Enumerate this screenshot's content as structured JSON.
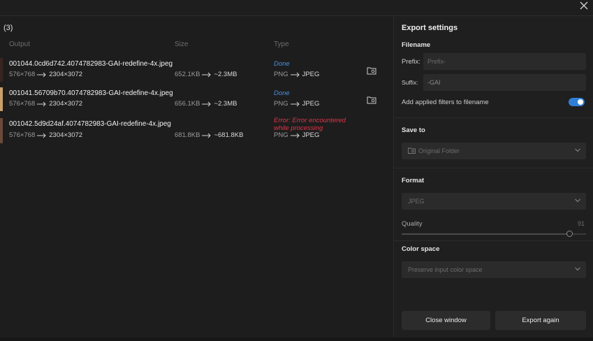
{
  "list": {
    "count": "(3)",
    "columns": {
      "output": "Output",
      "size": "Size",
      "type": "Type"
    },
    "rows": [
      {
        "filename": "001044.0cd6d742.4074782983-GAI-redefine-4x.jpeg",
        "dims_from": "576×768",
        "dims_to": "2304×3072",
        "size_from": "652.1KB",
        "size_to": "~2.3MB",
        "status": "Done",
        "type_from": "PNG",
        "type_to": "JPEG",
        "thumb_color": "#3a2420"
      },
      {
        "filename": "001041.56709b70.4074782983-GAI-redefine-4x.jpeg",
        "dims_from": "576×768",
        "dims_to": "2304×3072",
        "size_from": "656.1KB",
        "size_to": "~2.3MB",
        "status": "Done",
        "type_from": "PNG",
        "type_to": "JPEG",
        "thumb_color": "#c9a06a"
      },
      {
        "filename": "001042.5d9d24af.4074782983-GAI-redefine-4x.jpeg",
        "dims_from": "576×768",
        "dims_to": "2304×3072",
        "size_from": "681.8KB",
        "size_to": "~681.8KB",
        "status": "Error: Error encountered while processing",
        "type_from": "PNG",
        "type_to": "JPEG",
        "thumb_color": "#6a4a38"
      }
    ]
  },
  "settings": {
    "title": "Export settings",
    "filename_section": "Filename",
    "prefix_label": "Prefix:",
    "prefix_placeholder": "Prefix-",
    "suffix_label": "Suffix:",
    "suffix_value": "-GAI",
    "filters_label": "Add applied filters to filename",
    "filters_enabled": true,
    "save_to_section": "Save to",
    "save_to_value": "Original Folder",
    "format_section": "Format",
    "format_value": "JPEG",
    "quality_label": "Quality",
    "quality_value": "91",
    "color_space_section": "Color space",
    "color_space_value": "Preserve input color space",
    "close_button": "Close window",
    "export_button": "Export again"
  },
  "colors": {
    "accent": "#2f7fd8",
    "done": "#4a8fe0",
    "error": "#e0354a"
  }
}
